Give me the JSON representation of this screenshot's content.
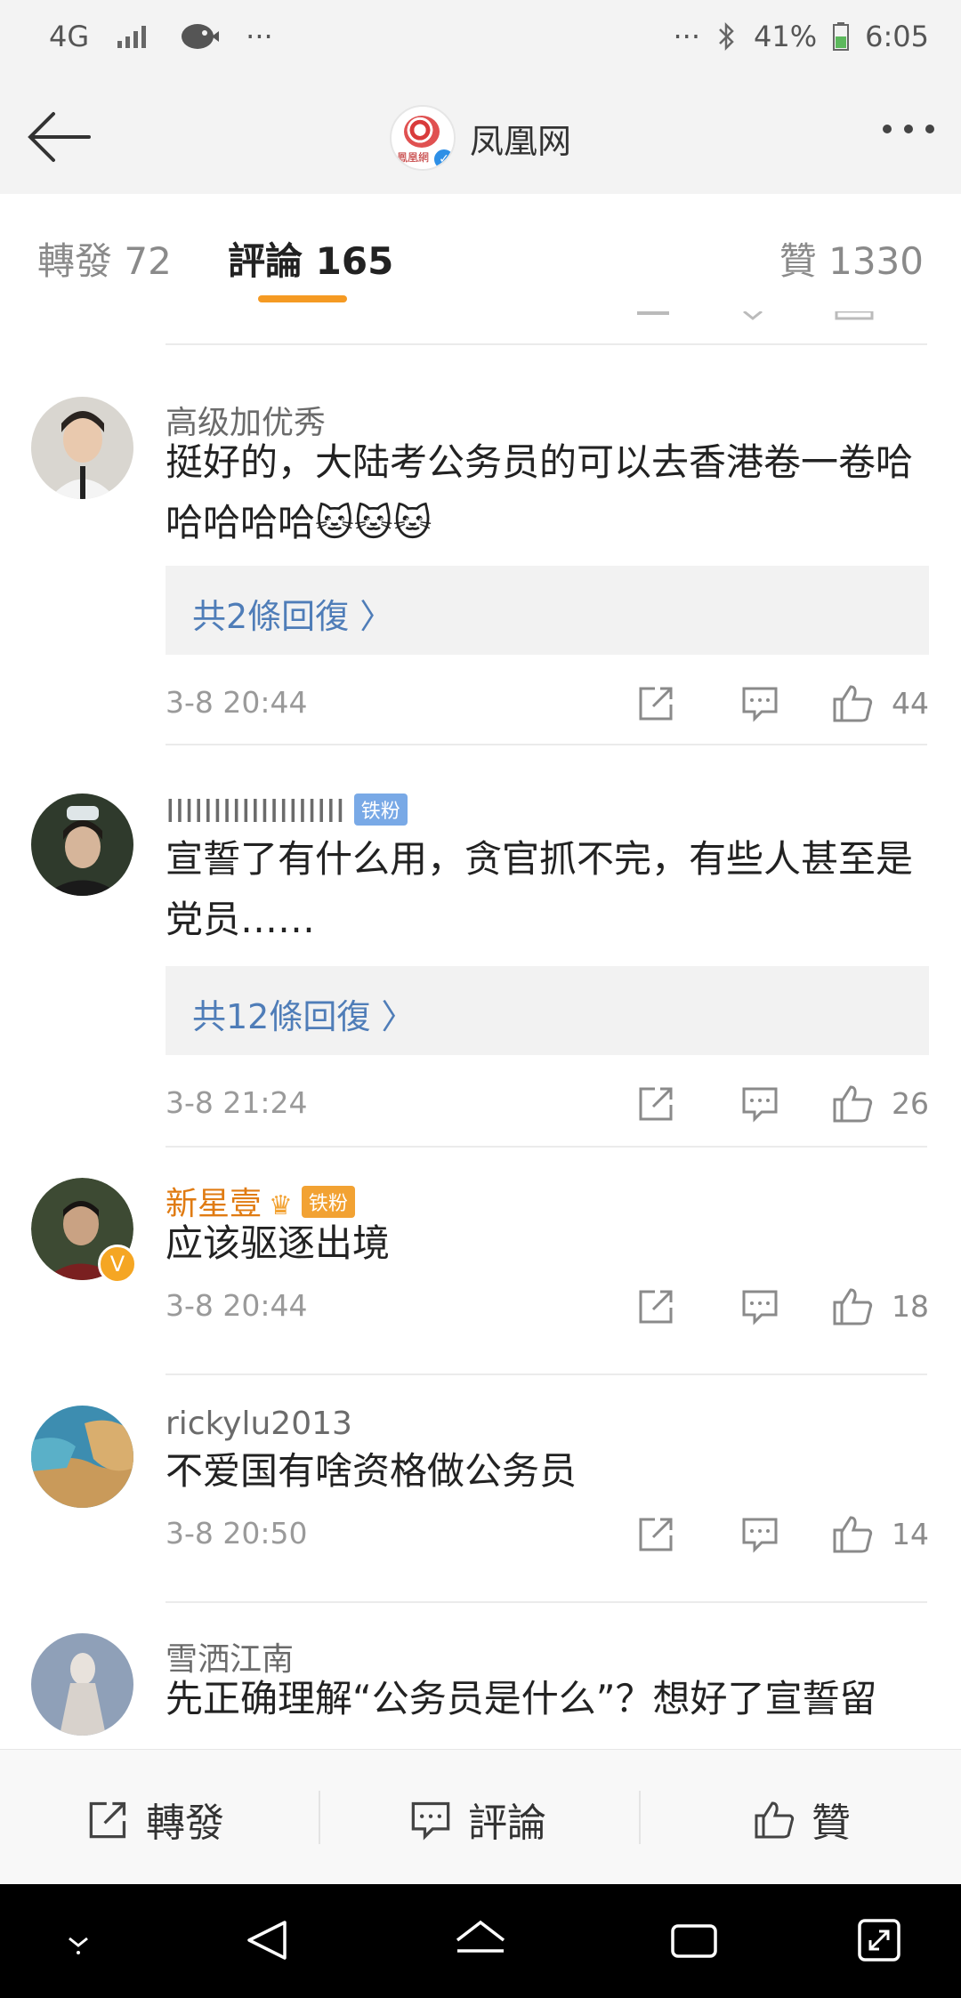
{
  "status_bar": {
    "network": "4G",
    "dots_left": "···",
    "dots_right": "···",
    "battery": "41%",
    "time": "6:05"
  },
  "header": {
    "account_name": "凤凰网",
    "logo_text": "鳳凰網"
  },
  "tabs": [
    {
      "label": "轉發 72"
    },
    {
      "label": "評論 165"
    },
    {
      "label": "贊 1330"
    }
  ],
  "comments": [
    {
      "username": "高级加优秀",
      "text": "挺好的，大陆考公务员的可以去香港卷一卷哈哈哈哈哈🐱🐱🐱",
      "reply_link": "共2條回復 〉",
      "time": "3-8 20:44",
      "likes": "44"
    },
    {
      "username": "IIIIIIIIIIIIIIIIIII",
      "badge": "铁粉",
      "text": "宣誓了有什么用，贪官抓不完，有些人甚至是党员……",
      "reply_link": "共12條回復 〉",
      "time": "3-8 21:24",
      "likes": "26"
    },
    {
      "username": "新星壹",
      "badge": "铁粉",
      "text": "应该驱逐出境",
      "time": "3-8 20:44",
      "likes": "18"
    },
    {
      "username": "rickylu2013",
      "text": "不爱国有啥资格做公务员",
      "time": "3-8 20:50",
      "likes": "14"
    },
    {
      "username": "雪洒江南",
      "text": "先正确理解“公务员是什么”？想好了宣誓留"
    }
  ],
  "bottom_bar": {
    "repost": "轉發",
    "comment": "評論",
    "like": "贊"
  },
  "colors": {
    "accent": "#f59a23",
    "link": "#4f7db8",
    "vip_name": "#e07b12"
  }
}
